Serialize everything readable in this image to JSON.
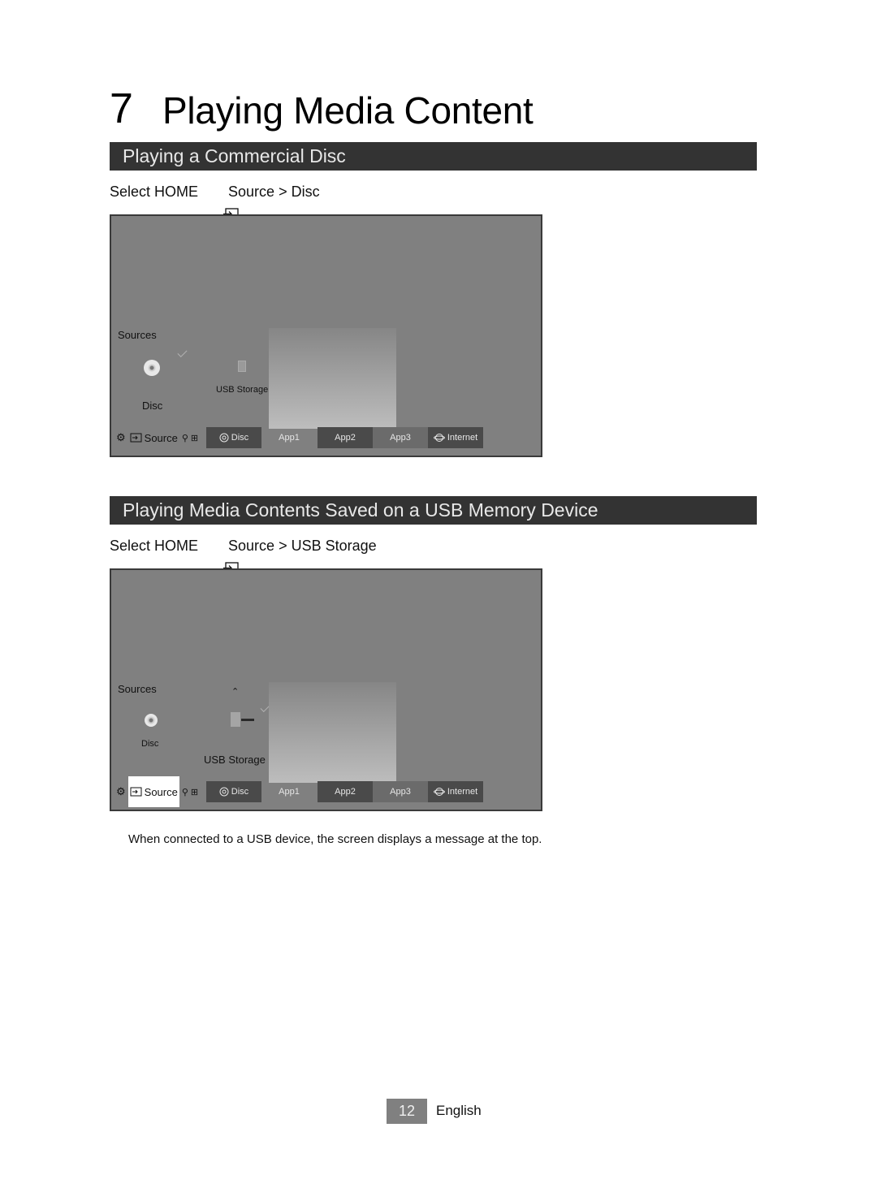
{
  "chapter": {
    "number": "7",
    "title": "Playing Media Content"
  },
  "sections": [
    {
      "title": "Playing  a Commercial Disc",
      "instruction": {
        "prefix": "Select HOME",
        "icon": "input-source-icon",
        "path": "Source > Disc"
      },
      "screen": {
        "sources_label": "Sources",
        "items": [
          {
            "label": "Disc",
            "icon": "disc-icon",
            "checked": true
          },
          {
            "label": "USB Storage",
            "icon": "usb-drive-icon",
            "checked": false
          }
        ],
        "taskbar": {
          "left": {
            "settings_icon": "gear-icon",
            "source_icon": "input-source-icon",
            "source_label": "Source",
            "search_icon": "search-icon",
            "apps_icon": "grid-icon"
          },
          "buttons": [
            {
              "label": "Disc",
              "icon": "disc-icon"
            },
            {
              "label": "App1"
            },
            {
              "label": "App2"
            },
            {
              "label": "App3"
            },
            {
              "label": "Internet",
              "icon": "globe-icon"
            }
          ]
        }
      }
    },
    {
      "title": "Playing Media Contents Saved on a USB Memory Device",
      "instruction": {
        "prefix": "Select HOME",
        "icon": "input-source-icon",
        "path": "Source > USB Storage"
      },
      "screen": {
        "sources_label": "Sources",
        "items": [
          {
            "label": "Disc",
            "icon": "disc-icon",
            "checked": false
          },
          {
            "label": "USB Storage",
            "icon": "usb-drive-icon",
            "checked": true
          }
        ],
        "taskbar": {
          "left": {
            "settings_icon": "gear-icon",
            "source_icon": "input-source-icon",
            "source_label": "Source",
            "search_icon": "search-icon",
            "apps_icon": "grid-icon",
            "highlighted": true
          },
          "buttons": [
            {
              "label": "Disc",
              "icon": "disc-icon"
            },
            {
              "label": "App1"
            },
            {
              "label": "App2"
            },
            {
              "label": "App3"
            },
            {
              "label": "Internet",
              "icon": "globe-icon"
            }
          ]
        }
      }
    }
  ],
  "note": "When connected to a USB device, the screen displays a message at the top.",
  "footer": {
    "page_number": "12",
    "language": "English"
  }
}
